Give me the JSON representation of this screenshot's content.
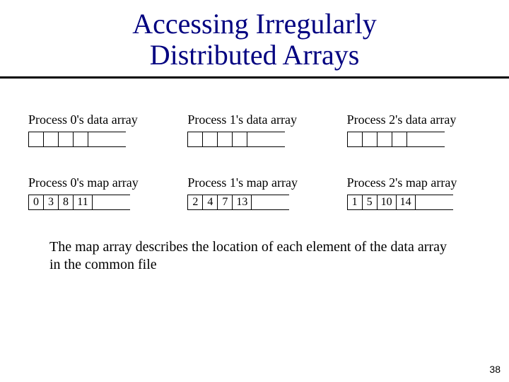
{
  "title_line1": "Accessing Irregularly",
  "title_line2": "Distributed Arrays",
  "columns": [
    {
      "data_label": "Process 0's data array",
      "map_label": "Process 0's map array",
      "map": [
        "0",
        "3",
        "8",
        "11"
      ]
    },
    {
      "data_label": "Process 1's data array",
      "map_label": "Process 1's map array",
      "map": [
        "2",
        "4",
        "7",
        "13"
      ]
    },
    {
      "data_label": "Process 2's data array",
      "map_label": "Process 2's map array",
      "map": [
        "1",
        "5",
        "10",
        "14"
      ]
    }
  ],
  "caption": "The map array describes the location of each element of the data array in the common file",
  "page_number": "38"
}
